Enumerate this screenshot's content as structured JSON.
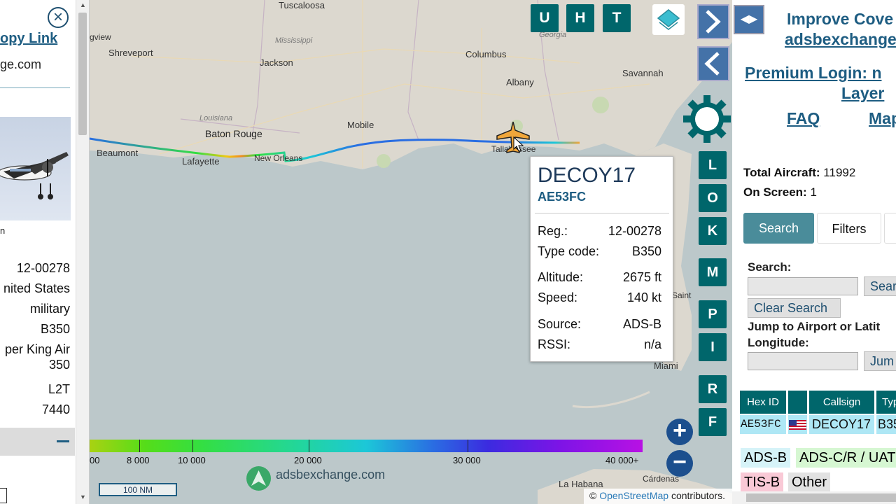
{
  "left_panel": {
    "copy_link": "opy Link",
    "site_fragment": "ge.com",
    "photo_caption": "n",
    "details": [
      "12-00278",
      "nited States",
      "military",
      "B350",
      "per King Air",
      "350",
      "L2T",
      "7440"
    ]
  },
  "map": {
    "cities": [
      "Tuscaloosa",
      "Shreveport",
      "Jackson",
      "Columbus",
      "Savannah",
      "Albany",
      "Baton Rouge",
      "Mobile",
      "Beaumont",
      "Lafayette",
      "New Orleans",
      "Tallahassee",
      "Miami",
      "La Habana",
      "Cárdenas",
      "gview",
      "Saint"
    ],
    "states": [
      "Mississippi",
      "Georgia",
      "Louisiana"
    ],
    "toolbar": {
      "u": "U",
      "h": "H",
      "t": "T"
    },
    "side_buttons": {
      "l": "L",
      "o": "O",
      "k": "K",
      "m": "M",
      "p": "P",
      "i": "I",
      "r": "R",
      "f": "F"
    },
    "zoom_in": "+",
    "zoom_out": "−",
    "legend_labels": [
      "00",
      "8 000",
      "10 000",
      "20 000",
      "30 000",
      "40 000+"
    ],
    "scale_label": "100 NM",
    "brand": "adsbexchange.com",
    "attribution_prefix": "©",
    "attribution_link": "OpenStreetMap",
    "attribution_suffix": "contributors."
  },
  "popup": {
    "callsign": "DECOY17",
    "hex": "AE53FC",
    "rows": [
      {
        "label": "Reg.:",
        "value": "12-00278"
      },
      {
        "label": "Type code:",
        "value": "B350"
      },
      {
        "label": "Altitude:",
        "value": "2675 ft"
      },
      {
        "label": "Speed:",
        "value": "140 kt"
      },
      {
        "label": "Source:",
        "value": "ADS-B"
      },
      {
        "label": "RSSI:",
        "value": "n/a"
      }
    ]
  },
  "right_panel": {
    "improve_line1": "Improve Cove",
    "improve_line2": "adsbexchange",
    "premium_line1": "Premium Login: n",
    "premium_line2": "Layer",
    "faq": "FAQ",
    "map_link": "Map",
    "total_label": "Total Aircraft:",
    "total_value": "11992",
    "onscreen_label": "On Screen:",
    "onscreen_value": "1",
    "tab_search": "Search",
    "tab_filters": "Filters",
    "search_label": "Search:",
    "search_button": "Sear",
    "clear_button": "Clear Search",
    "jump_label_1": "Jump to Airport or Latit",
    "jump_label_2": "Longitude:",
    "jump_button": "Jum",
    "table_headers": [
      "Hex ID",
      "",
      "Callsign",
      "Typ"
    ],
    "table_row": {
      "hex": "AE53FC",
      "callsign": "DECOY17",
      "type": "B35"
    },
    "source_chips": [
      {
        "label": "ADS-B",
        "color": "#d6f3f8"
      },
      {
        "label": "ADS-C/R / UAT",
        "color": "#d6f7d2"
      },
      {
        "label": "TIS-B",
        "color": "#f9c9d6"
      },
      {
        "label": "Other",
        "color": "#e2e2e2"
      }
    ]
  },
  "colors": {
    "accent": "#00666b",
    "link": "#1e5d82",
    "nav": "#4472a8",
    "aircraft": "#f0a63a"
  }
}
